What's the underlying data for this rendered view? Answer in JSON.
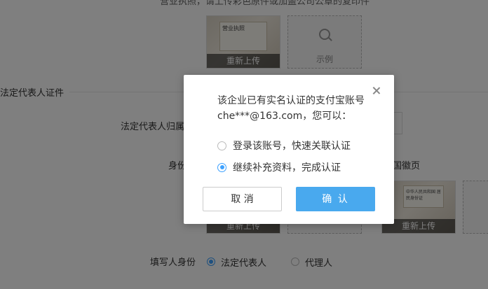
{
  "background": {
    "top_note": "营业执照，请上传彩色原件或加盖公司公章的复印件",
    "license_thumb": {
      "bar_label": "重新上传",
      "doc_title": "营业执照"
    },
    "license_sample": {
      "label": "示例"
    },
    "section_title": "法定代表人证件",
    "legal_rep_region_label": "法定代表人归属地",
    "id_label": "身份证",
    "emblem_side_label": "国徽页",
    "id_front_bar": "重新上传",
    "id_back_bar": "重新上传",
    "id_back_doc": "中华人民共和国 居民身份证",
    "filler_label": "填写人身份",
    "filler_options": [
      {
        "label": "法定代表人",
        "selected": true
      },
      {
        "label": "代理人",
        "selected": false
      }
    ]
  },
  "modal": {
    "message_line1": "该企业已有实名认证的支付宝账号",
    "message_line2": "che***@163.com，您可以：",
    "options": [
      {
        "label": "登录该账号，快速关联认证",
        "selected": false
      },
      {
        "label": "继续补充资料，完成认证",
        "selected": true
      }
    ],
    "cancel_label": "取 消",
    "confirm_label": "确 认"
  },
  "colors": {
    "accent": "#49a9ee",
    "radio_selected": "#3da1ff",
    "mask": "rgba(0,0,0,0.5)"
  }
}
